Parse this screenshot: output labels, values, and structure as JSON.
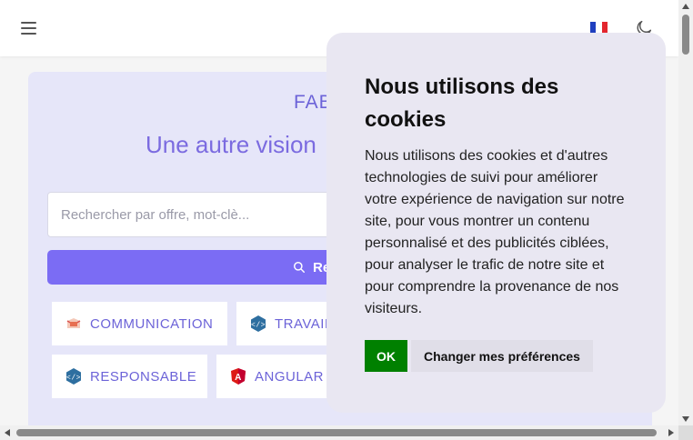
{
  "header": {
    "menu_icon": "hamburger-menu-icon",
    "language_flag": "flag-france-icon",
    "theme_toggle_icon": "moon-icon"
  },
  "hero": {
    "brand": "FAB",
    "tagline": "Une autre vision",
    "search": {
      "placeholder": "Rechercher par offre, mot-clè...",
      "button_label": "Re"
    },
    "tags": [
      {
        "label": "COMMUNICATION",
        "icon": "communication-icon"
      },
      {
        "label": "TRAVAIL",
        "icon": "code-icon"
      },
      {
        "label": "RESPONSABLE",
        "icon": "code-icon"
      },
      {
        "label": "ANGULAR",
        "icon": "angular-icon"
      }
    ]
  },
  "cookie_modal": {
    "title": "Nous utilisons des cookies",
    "body": "Nous utilisons des cookies et d'autres technologies de suivi pour améliorer votre expérience de navigation sur notre site, pour vous montrer un contenu personnalisé et des publicités ciblées, pour analyser le trafic de notre site et pour comprendre la provenance de nos visiteurs.",
    "accept_label": "OK",
    "preferences_label": "Changer mes préférences",
    "accept_color": "#008000"
  },
  "colors": {
    "accent": "#7b6cf4",
    "hero_background": "#e6e6f9",
    "modal_background": "#e9e7f2"
  }
}
